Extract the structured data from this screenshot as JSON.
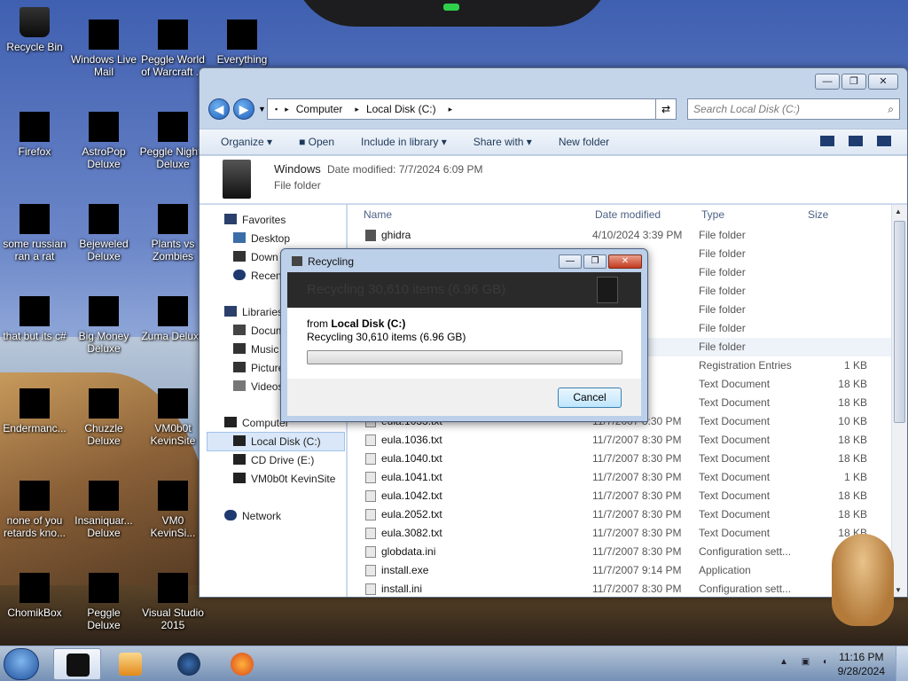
{
  "desktop": {
    "icons": [
      {
        "label": "Recycle Bin"
      },
      {
        "label": "Windows Live Mail"
      },
      {
        "label": "Peggle World of Warcraft ..."
      },
      {
        "label": "Everything"
      },
      {
        "label": "Firefox"
      },
      {
        "label": "AstroPop Deluxe"
      },
      {
        "label": "Peggle Nights Deluxe"
      },
      {
        "label": "some russian ran a rat"
      },
      {
        "label": "Bejeweled Deluxe"
      },
      {
        "label": "Plants vs Zombies"
      },
      {
        "label": "that but its c#"
      },
      {
        "label": "Big Money Deluxe"
      },
      {
        "label": "Zuma Deluxe"
      },
      {
        "label": "Endermanc..."
      },
      {
        "label": "Chuzzle Deluxe"
      },
      {
        "label": "VM0b0t KevinSite"
      },
      {
        "label": "none of you retards kno..."
      },
      {
        "label": "Insaniquar... Deluxe"
      },
      {
        "label": "VM0 KevinSi..."
      },
      {
        "label": "ChomikBox"
      },
      {
        "label": "Peggle Deluxe"
      },
      {
        "label": "Visual Studio 2015"
      }
    ]
  },
  "explorer": {
    "address": {
      "crumbs": [
        "Computer",
        "Local Disk (C:)"
      ]
    },
    "search": {
      "placeholder": "Search Local Disk (C:)"
    },
    "toolbar": {
      "organize": "Organize ▾",
      "open": "Open",
      "include": "Include in library ▾",
      "share": "Share with ▾",
      "newfolder": "New folder"
    },
    "details": {
      "name": "Windows",
      "date_modified": "Date modified: 7/7/2024 6:09 PM",
      "type": "File folder"
    },
    "nav": {
      "favorites": "Favorites",
      "desktop": "Desktop",
      "downloads": "Down",
      "recent": "Recent",
      "libraries": "Libraries",
      "documents": "Docum",
      "music": "Music",
      "pictures": "Picture",
      "videos": "Videos",
      "computer": "Computer",
      "localdisk": "Local Disk (C:)",
      "cddrive": "CD Drive (E:)",
      "kevinsite": "VM0b0t KevinSite",
      "network": "Network"
    },
    "columns": {
      "name": "Name",
      "date": "Date modified",
      "type": "Type",
      "size": "Size"
    },
    "files": [
      {
        "name": "ghidra",
        "date": "4/10/2024 3:39 PM",
        "type": "File folder",
        "size": "",
        "icon": "folder"
      },
      {
        "name": "",
        "date": "50 AM",
        "type": "File folder",
        "size": "",
        "icon": "folder"
      },
      {
        "name": "",
        "date": "3 PM",
        "type": "File folder",
        "size": "",
        "icon": "folder"
      },
      {
        "name": "",
        "date": "26 PM",
        "type": "File folder",
        "size": "",
        "icon": "folder"
      },
      {
        "name": "",
        "date": "5 PM",
        "type": "File folder",
        "size": "",
        "icon": "folder"
      },
      {
        "name": "",
        "date": "5 PM",
        "type": "File folder",
        "size": "",
        "icon": "folder"
      },
      {
        "name": "",
        "date": "9 PM",
        "type": "File folder",
        "size": "",
        "icon": "folder"
      },
      {
        "name": "",
        "date": "08 AM",
        "type": "Registration Entries",
        "size": "1 KB",
        "icon": "doc"
      },
      {
        "name": "",
        "date": "30 PM",
        "type": "Text Document",
        "size": "18 KB",
        "icon": "doc"
      },
      {
        "name": "",
        "date": "30 PM",
        "type": "Text Document",
        "size": "18 KB",
        "icon": "doc"
      },
      {
        "name": "eula.1033.txt",
        "date": "11/7/2007 8:30 PM",
        "type": "Text Document",
        "size": "10 KB",
        "icon": "doc"
      },
      {
        "name": "eula.1036.txt",
        "date": "11/7/2007 8:30 PM",
        "type": "Text Document",
        "size": "18 KB",
        "icon": "doc"
      },
      {
        "name": "eula.1040.txt",
        "date": "11/7/2007 8:30 PM",
        "type": "Text Document",
        "size": "18 KB",
        "icon": "doc"
      },
      {
        "name": "eula.1041.txt",
        "date": "11/7/2007 8:30 PM",
        "type": "Text Document",
        "size": "1 KB",
        "icon": "doc"
      },
      {
        "name": "eula.1042.txt",
        "date": "11/7/2007 8:30 PM",
        "type": "Text Document",
        "size": "18 KB",
        "icon": "doc"
      },
      {
        "name": "eula.2052.txt",
        "date": "11/7/2007 8:30 PM",
        "type": "Text Document",
        "size": "18 KB",
        "icon": "doc"
      },
      {
        "name": "eula.3082.txt",
        "date": "11/7/2007 8:30 PM",
        "type": "Text Document",
        "size": "18 KB",
        "icon": "doc"
      },
      {
        "name": "globdata.ini",
        "date": "11/7/2007 8:30 PM",
        "type": "Configuration sett...",
        "size": "",
        "icon": "doc"
      },
      {
        "name": "install.exe",
        "date": "11/7/2007 9:14 PM",
        "type": "Application",
        "size": "",
        "icon": "exe"
      },
      {
        "name": "install.ini",
        "date": "11/7/2007 8:30 PM",
        "type": "Configuration sett...",
        "size": "",
        "icon": "doc"
      }
    ]
  },
  "dialog": {
    "title": "Recycling",
    "banner": "Recycling 30,610 items (6.96 GB)",
    "from_prefix": "from",
    "from_location": "Local Disk (C:)",
    "sub": "Recycling 30,610 items (6.96 GB)",
    "progress": 0,
    "cancel": "Cancel"
  },
  "taskbar": {
    "time": "11:16 PM",
    "date": "9/28/2024"
  }
}
